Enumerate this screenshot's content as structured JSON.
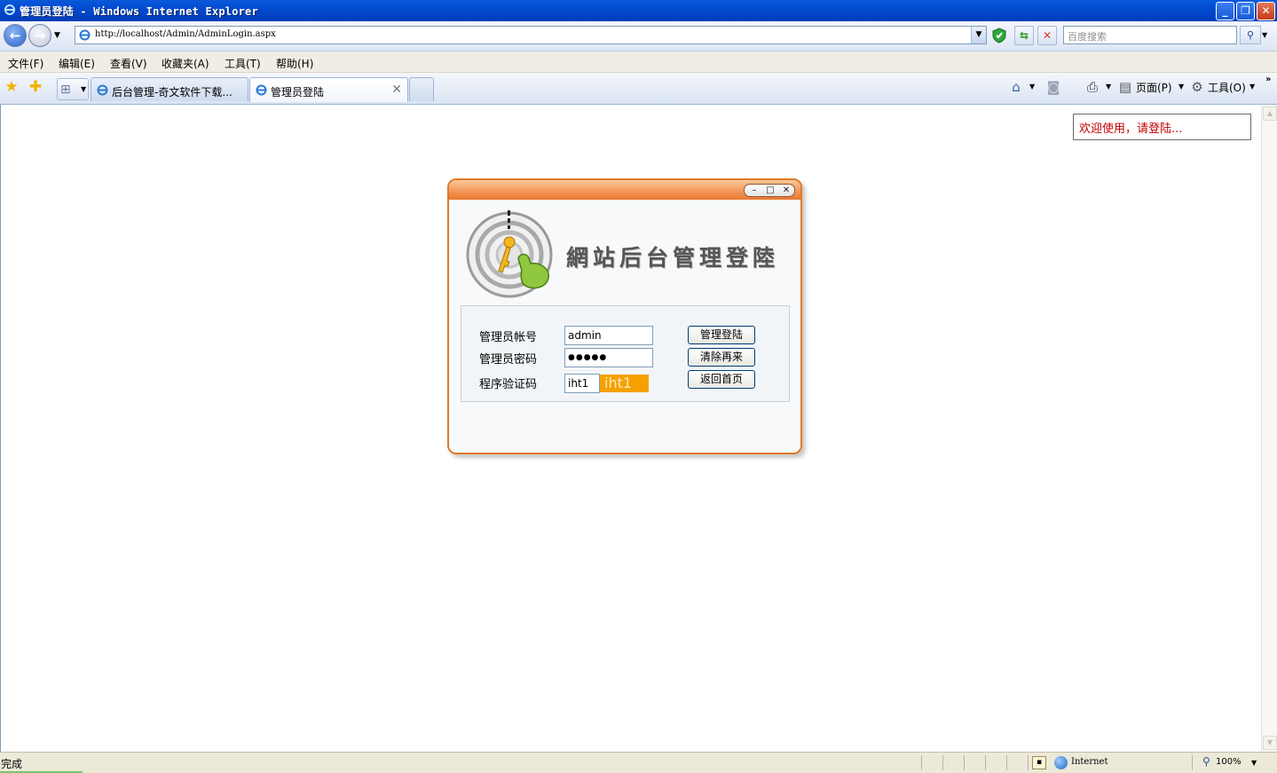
{
  "window": {
    "title": "管理员登陆 - Windows Internet Explorer",
    "minimize": "_",
    "maximize": "❐",
    "close": "✕"
  },
  "address_bar": {
    "url": "http://localhost/Admin/AdminLogin.aspx",
    "search_placeholder": "百度搜索"
  },
  "menu": [
    {
      "label": "文件(F)"
    },
    {
      "label": "编辑(E)"
    },
    {
      "label": "查看(V)"
    },
    {
      "label": "收藏夹(A)"
    },
    {
      "label": "工具(T)"
    },
    {
      "label": "帮助(H)"
    }
  ],
  "tabs": [
    {
      "label": "后台管理-奇文软件下载..."
    },
    {
      "label": "管理员登陆",
      "active": true
    }
  ],
  "command_bar": {
    "page": "页面(P)",
    "tools": "工具(O)"
  },
  "page": {
    "welcome": "欢迎使用，请登陆...",
    "login": {
      "title": "網站后台管理登陸",
      "account_label": "管理员帐号",
      "account_value": "admin",
      "password_label": "管理员密码",
      "password_value": "●●●●●",
      "captcha_label": "程序验证码",
      "captcha_value": "iht1",
      "captcha_image_text": "iht1",
      "login_button": "管理登陆",
      "clear_button": "清除再来",
      "home_button": "返回首页"
    }
  },
  "status_bar": {
    "status": "完成",
    "zone": "Internet",
    "zoom": "100%"
  },
  "colors": {
    "accent_orange": "#e8772f",
    "welcome_red": "#c00000",
    "captcha_bg": "#f5a100"
  }
}
